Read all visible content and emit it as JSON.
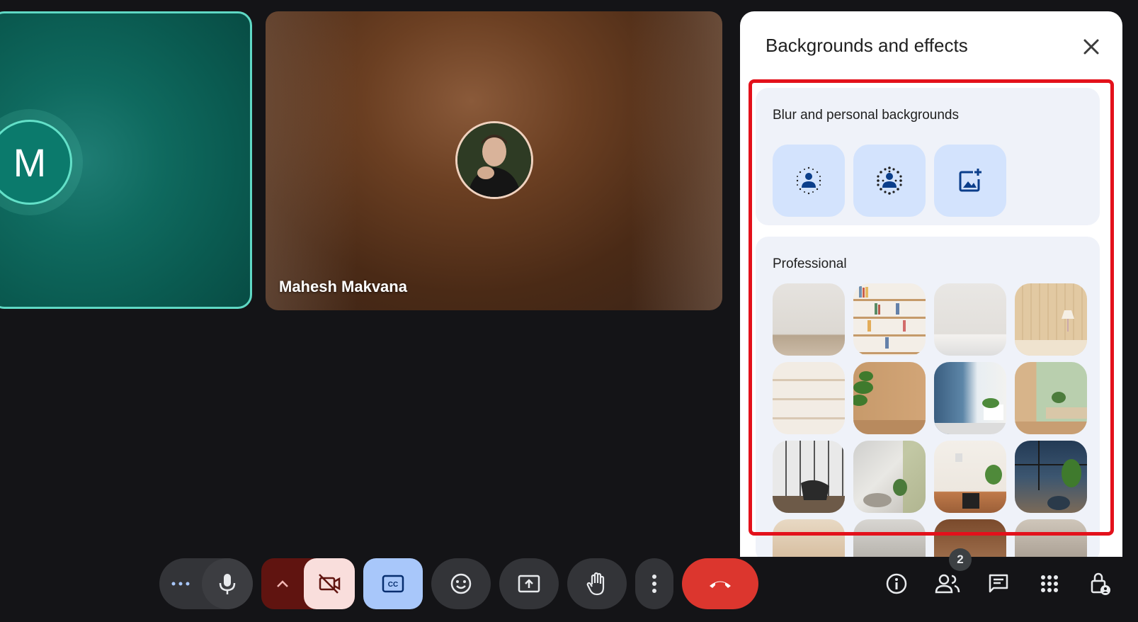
{
  "tiles": {
    "left_avatar_initial": "M",
    "main_participant_name": "Mahesh Makvana"
  },
  "panel": {
    "title": "Backgrounds and effects",
    "blur_section": {
      "title": "Blur and personal backgrounds",
      "options": [
        {
          "name": "slightly-blur-icon"
        },
        {
          "name": "blur-icon"
        },
        {
          "name": "upload-background-icon"
        }
      ]
    },
    "professional_section": {
      "title": "Professional",
      "thumbnails": [
        "minimal-room",
        "bookshelf",
        "white-shelf",
        "wood-wall-lamp",
        "white-shelves",
        "wood-plant",
        "city-window",
        "green-room",
        "library-chair",
        "sunlit-room",
        "desk-plant",
        "dark-window-plant",
        "partial-1",
        "partial-2",
        "partial-3",
        "partial-4"
      ]
    }
  },
  "controls": {
    "participant_count": "2"
  },
  "colors": {
    "accent_red": "#e3111b",
    "end_call_red": "#dc362e",
    "option_blue": "#d3e3fd",
    "teal": "#0b7a6c"
  }
}
